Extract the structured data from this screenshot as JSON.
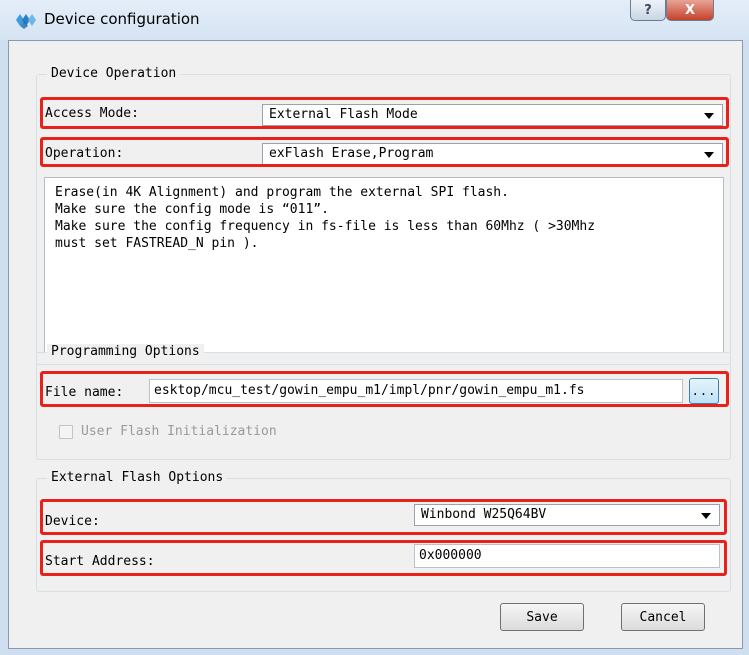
{
  "window": {
    "title": "Device configuration",
    "help_label": "?",
    "close_label": "X"
  },
  "device_operation": {
    "group_title": "Device Operation",
    "access_mode_label": "Access Mode:",
    "access_mode_value": "External Flash Mode",
    "operation_label": "Operation:",
    "operation_value": "exFlash Erase,Program",
    "description": "Erase(in 4K Alignment) and program the external SPI flash.\nMake sure the config mode is “011”.\nMake sure the config frequency in fs-file is less than 60Mhz ( >30Mhz\nmust set FASTREAD_N pin )."
  },
  "programming_options": {
    "group_title": "Programming Options",
    "file_name_label": "File name:",
    "file_name_value": "esktop/mcu_test/gowin_empu_m1/impl/pnr/gowin_empu_m1.fs",
    "browse_label": "...",
    "user_flash_label": "User Flash Initialization"
  },
  "external_flash_options": {
    "group_title": "External Flash Options",
    "device_label": "Device:",
    "device_value": "Winbond W25Q64BV",
    "start_address_label": "Start Address:",
    "start_address_value": "0x000000"
  },
  "footer": {
    "save_label": "Save",
    "cancel_label": "Cancel"
  },
  "colors": {
    "highlight": "#e8211a",
    "title_bar": "#d5e3f2",
    "close_button": "#c5412c"
  }
}
